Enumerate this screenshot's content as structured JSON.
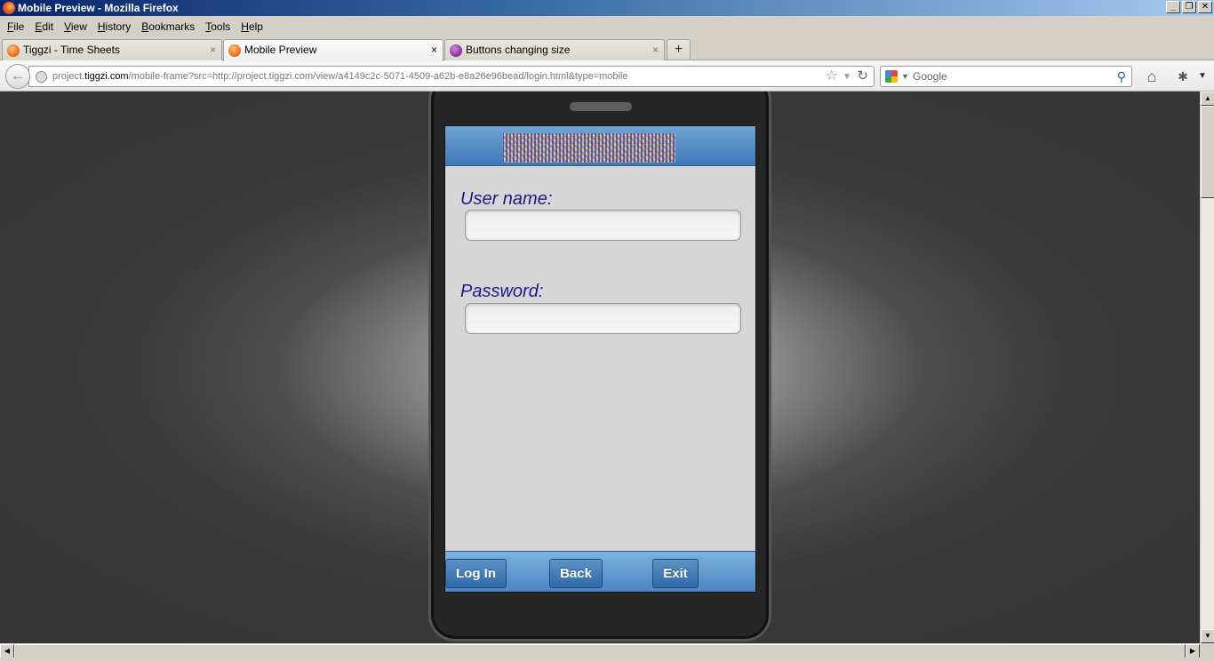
{
  "window": {
    "title": "Mobile Preview - Mozilla Firefox",
    "controls": [
      "minimize",
      "restore",
      "close"
    ]
  },
  "menubar": {
    "items": [
      {
        "label": "File",
        "accel": "F",
        "rest": "ile"
      },
      {
        "label": "Edit",
        "accel": "E",
        "rest": "dit"
      },
      {
        "label": "View",
        "accel": "V",
        "rest": "iew"
      },
      {
        "label": "History",
        "accel": "H",
        "rest": "istory"
      },
      {
        "label": "Bookmarks",
        "accel": "B",
        "rest": "ookmarks"
      },
      {
        "label": "Tools",
        "accel": "T",
        "rest": "ools"
      },
      {
        "label": "Help",
        "accel": "H",
        "rest": "elp"
      }
    ]
  },
  "tabs": [
    {
      "label": "Tiggzi - Time Sheets",
      "icon": "tiggzi-icon",
      "active": false,
      "close": "×"
    },
    {
      "label": "Mobile Preview",
      "icon": "tiggzi-icon",
      "active": true,
      "close": "×"
    },
    {
      "label": "Buttons changing size",
      "icon": "support-icon",
      "active": false,
      "close": "×"
    }
  ],
  "newtab": {
    "label": "+"
  },
  "navbar": {
    "url_prefix": "project.",
    "url_domain": "tiggzi.com",
    "url_rest": "/mobile-frame?src=http://project.tiggzi.com/view/a4149c2c-5071-4509-a62b-e8a26e96bead/login.html&type=mobile",
    "search_placeholder": "Google"
  },
  "app": {
    "username_label": "User name:",
    "username_value": "",
    "password_label": "Password:",
    "password_value": "",
    "buttons": {
      "login": "Log In",
      "back": "Back",
      "exit": "Exit"
    }
  },
  "colors": {
    "header_blue": "#3e7ab9",
    "label_navy": "#1a1a8a",
    "phone_body": "#262626"
  }
}
